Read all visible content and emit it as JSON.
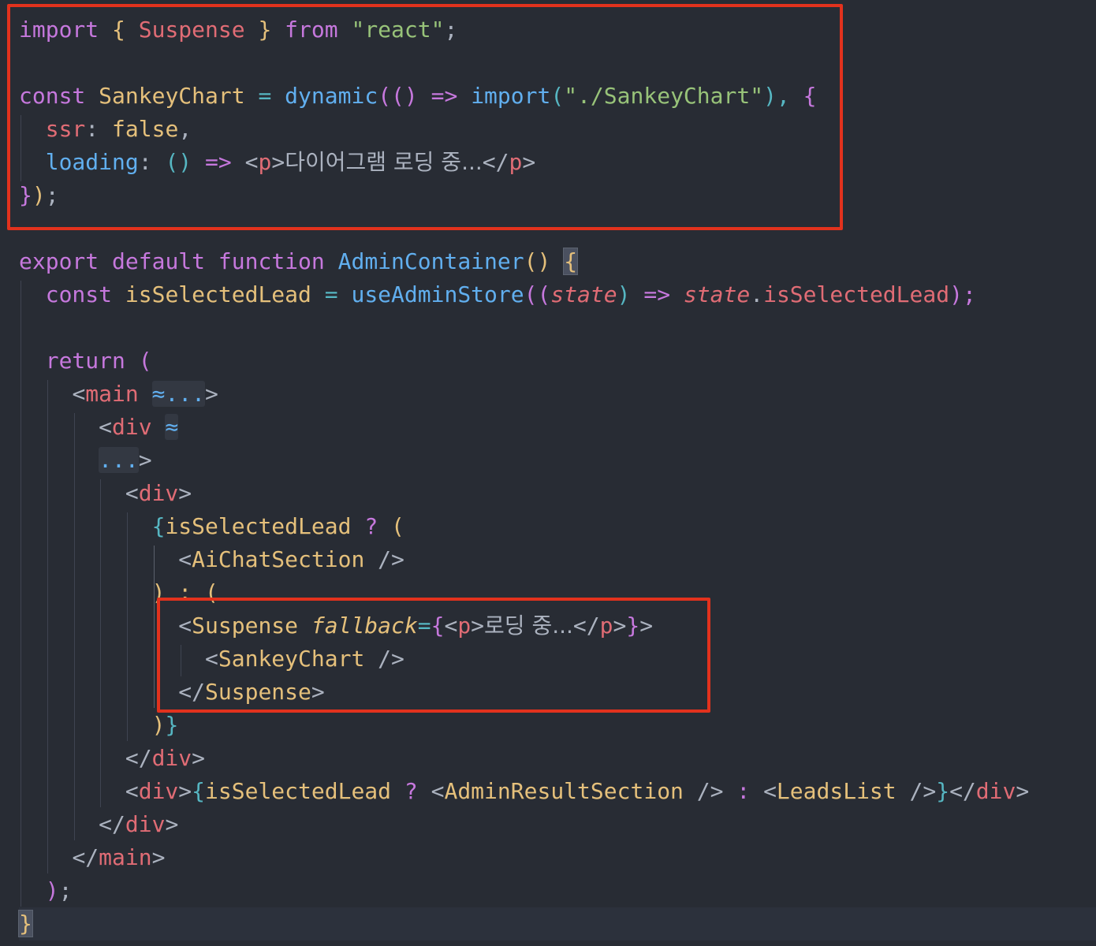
{
  "colors": {
    "background": "#282c34",
    "highlight_box": "#e2321d",
    "keyword": "#c678dd",
    "function": "#61afef",
    "tag": "#e06c75",
    "component": "#e5c07b",
    "string": "#98c379",
    "text": "#abb2bf"
  },
  "code": {
    "l1": {
      "import": "import",
      "ob": "{",
      "suspense": " Suspense ",
      "cb": "}",
      "from": "from",
      "str": "\"react\"",
      "semi": ";"
    },
    "l3": {
      "const": "const",
      "name": "SankeyChart",
      "eq": "=",
      "dynamic": "dynamic",
      "p1": "((",
      "p2": ")",
      "arrow": "=>",
      "import": "import",
      "p3": "(",
      "str": "\"./SankeyChart\"",
      "p4": "),",
      "ob": "{"
    },
    "l4": {
      "prop": "ssr",
      "colon": ":",
      "val": "false",
      "comma": ","
    },
    "l5": {
      "prop": "loading",
      "colon": ":",
      "parens": "()",
      "arrow": "=>",
      "lt": "<",
      "p": "p",
      "gt": ">",
      "text": "다이어그램 로딩 중...",
      "close_lt": "</",
      "p2": "p",
      "gt2": ">"
    },
    "l6": {
      "cb": "}",
      "cp": ")",
      "semi": ";"
    },
    "l8": {
      "export": "export",
      "default": "default",
      "function": "function",
      "name": "AdminContainer",
      "parens": "()",
      "ob": "{"
    },
    "l9": {
      "const": "const",
      "name": "isSelectedLead",
      "eq": "=",
      "fn": "useAdminStore",
      "p1": "((",
      "param": "state",
      "p2": ")",
      "arrow": "=>",
      "obj": "state",
      "dot": ".",
      "prop": "isSelectedLead",
      "p3": ");"
    },
    "l11": {
      "return": "return",
      "paren": "("
    },
    "l12": {
      "lt": "<",
      "tag": "main",
      "fold": "≈...",
      "gt": ">"
    },
    "l13": {
      "lt": "<",
      "tag": "div",
      "fold": "≈"
    },
    "l14": {
      "fold": "...",
      "gt": ">"
    },
    "l15": {
      "lt": "<",
      "tag": "div",
      "gt": ">"
    },
    "l16": {
      "ob": "{",
      "var": "isSelectedLead",
      "q": "?",
      "paren": "("
    },
    "l17": {
      "lt": "<",
      "comp": "AiChatSection",
      "end": "/>"
    },
    "l18": {
      "text": ") : ("
    },
    "l19": {
      "lt": "<",
      "comp": "Suspense",
      "attr": "fallback",
      "eq": "=",
      "ob": "{",
      "lt2": "<",
      "p": "p",
      "gt": ">",
      "text": "로딩 중...",
      "close_lt": "</",
      "p2": "p",
      "gt2": ">",
      "cb": "}",
      "gt3": ">"
    },
    "l20": {
      "lt": "<",
      "comp": "SankeyChart",
      "end": "/>"
    },
    "l21": {
      "lt": "</",
      "comp": "Suspense",
      "gt": ">"
    },
    "l22": {
      "cp": ")",
      "cb": "}"
    },
    "l23": {
      "lt": "</",
      "tag": "div",
      "gt": ">"
    },
    "l24": {
      "lt": "<",
      "tag": "div",
      "gt": ">",
      "ob": "{",
      "var": "isSelectedLead",
      "q": "?",
      "lt2": "<",
      "comp1": "AdminResultSection",
      "end1": "/>",
      "colon": ":",
      "lt3": "<",
      "comp2": "LeadsList",
      "end2": "/>",
      "cb": "}",
      "close_lt": "</",
      "tag2": "div",
      "gt2": ">"
    },
    "l25": {
      "lt": "</",
      "tag": "div",
      "gt": ">"
    },
    "l26": {
      "lt": "</",
      "tag": "main",
      "gt": ">"
    },
    "l27": {
      "cp": ")",
      "semi": ";"
    },
    "l28": {
      "cb": "}"
    }
  }
}
